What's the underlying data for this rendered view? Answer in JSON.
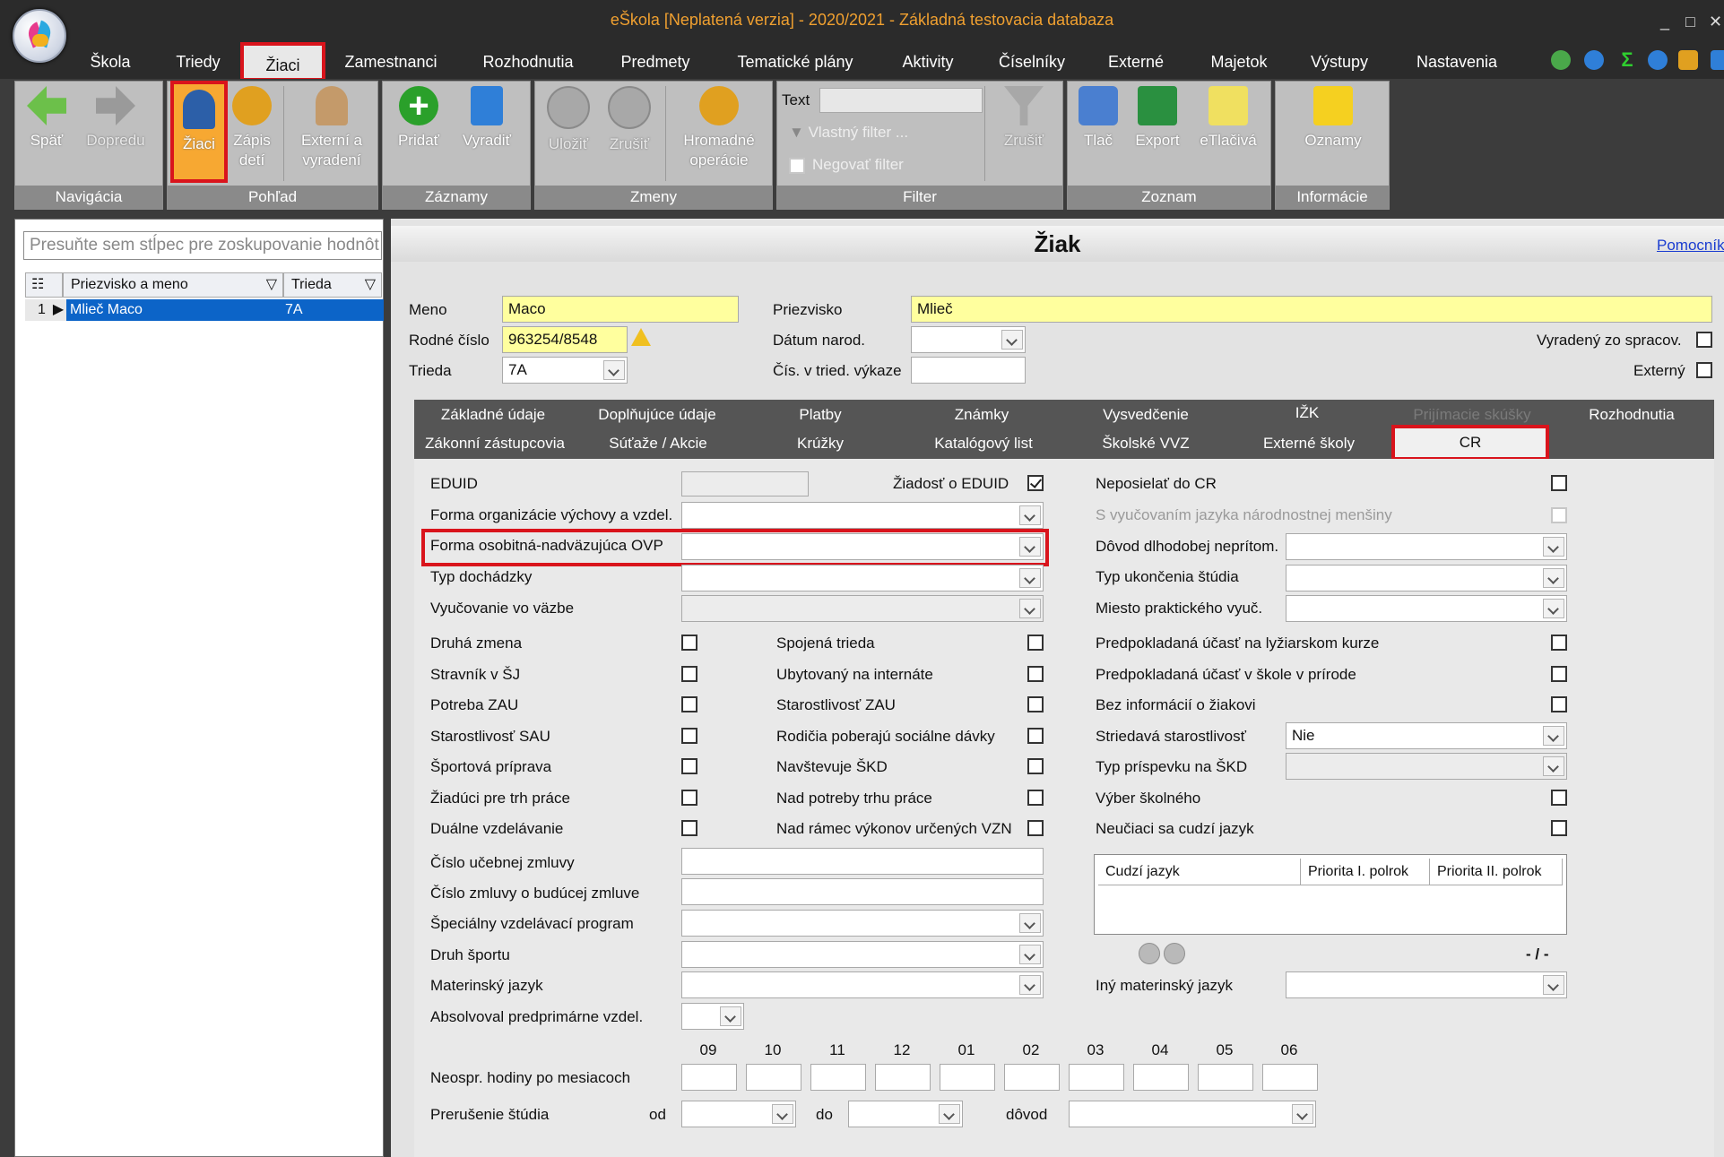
{
  "window": {
    "title": "eŠkola [Neplatená verzia] - 2020/2021 - Základná testovacia databaza",
    "min": "_",
    "max": "□",
    "close": "✕"
  },
  "menu": [
    "Škola",
    "Triedy",
    "Žiaci",
    "Zamestnanci",
    "Rozhodnutia",
    "Predmety",
    "Tematické plány",
    "Aktivity",
    "Číselníky",
    "Externé",
    "Majetok",
    "Výstupy",
    "Nastavenia"
  ],
  "ribbon": {
    "groups": {
      "navigation": "Navigácia",
      "view": "Pohľad",
      "records": "Záznamy",
      "changes": "Zmeny",
      "filter": "Filter",
      "list": "Zoznam",
      "info": "Informácie"
    },
    "buttons": {
      "back": "Späť",
      "forward": "Dopredu",
      "students": "Žiaci",
      "enrollment_1": "Zápis",
      "enrollment_2": "detí",
      "external_1": "Externí a",
      "external_2": "vyradení",
      "add": "Pridať",
      "remove": "Vyradiť",
      "save": "Uložiť",
      "cancel": "Zrušiť",
      "bulk_1": "Hromadné",
      "bulk_2": "operácie",
      "filter_cancel": "Zrušiť",
      "print": "Tlač",
      "export": "Export",
      "print_forms": "eTlačivá",
      "notices": "Oznamy"
    },
    "filter": {
      "text_label": "Text",
      "text_value": "",
      "custom_filter": "Vlastný filter ...",
      "negate_filter": "Negovať filter"
    }
  },
  "left": {
    "group_hint": "Presuňte sem stĺpec pre zoskupovanie hodnôt",
    "columns": {
      "name": "Priezvisko a meno",
      "class": "Trieda"
    },
    "rows": [
      {
        "num": "1",
        "name": "Mlieč Maco",
        "class": "7A"
      }
    ]
  },
  "detail": {
    "title": "Žiak",
    "help": "Pomocník",
    "first_name": {
      "label": "Meno",
      "value": "Maco"
    },
    "surname": {
      "label": "Priezvisko",
      "value": "Mlieč"
    },
    "birth_number": {
      "label": "Rodné číslo",
      "value": "963254/8548"
    },
    "birth_date": {
      "label": "Dátum narod.",
      "value": ""
    },
    "class": {
      "label": "Trieda",
      "value": "7A"
    },
    "class_number": {
      "label": "Čís. v tried. výkaze",
      "value": ""
    },
    "excluded": "Vyradený zo spracov.",
    "external": "Externý"
  },
  "tabs": {
    "row1": [
      "Základné údaje",
      "Doplňujúce údaje",
      "Platby",
      "Známky",
      "Vysvedčenie",
      "IŽK",
      "Prijímacie skúšky",
      "Rozhodnutia"
    ],
    "row2": [
      "Zákonní zástupcovia",
      "Súťaže / Akcie",
      "Krúžky",
      "Katalógový list",
      "Školské VVZ",
      "Externé školy",
      "CR"
    ]
  },
  "cr": {
    "eduid": "EDUID",
    "eduid_request": "Žiadosť o EDUID",
    "no_send": "Neposielať do CR",
    "minority_lang": "S vyučovaním jazyka národnostnej menšiny",
    "org_form": "Forma organizácie výchovy a vzdel.",
    "special_form": "Forma osobitná-nadväzujúca OVP",
    "absence_reason": "Dôvod dlhodobej neprítom.",
    "attendance": "Typ dochádzky",
    "end_type": "Typ ukončenia štúdia",
    "custody": "Vyučovanie vo väzbe",
    "practice_place": "Miesto praktického vyuč.",
    "checks_col1": [
      "Druhá zmena",
      "Stravník v ŠJ",
      "Potreba ZAU",
      "Starostlivosť SAU",
      "Športová príprava",
      "Žiadúci pre trh práce",
      "Duálne vzdelávanie"
    ],
    "checks_col2": [
      "Spojená trieda",
      "Ubytovaný na internáte",
      "Starostlivosť ZAU",
      "Rodičia poberajú sociálne dávky",
      "Navštevuje ŠKD",
      "Nad potreby trhu práce",
      "Nad rámec výkonov určených VZN"
    ],
    "checks_col3": [
      "Predpokladaná účasť na lyžiarskom kurze",
      "Predpokladaná účasť v škole v prírode",
      "Bez informácií o žiakovi"
    ],
    "alternating_care": {
      "label": "Striedavá starostlivosť",
      "value": "Nie"
    },
    "skd_fee": "Typ príspevku na ŠKD",
    "school_choice": "Výber školného",
    "no_foreign_lang": "Neučiaci sa cudzí jazyk",
    "lang_cols": [
      "Cudzí jazyk",
      "Priorita I. polrok",
      "Priorita II. polrok"
    ],
    "pager": "- / -",
    "contract_number": "Číslo učebnej zmluvy",
    "future_contract": "Číslo zmluvy o budúcej zmluve",
    "special_program": "Špeciálny vzdelávací program",
    "sport_type": "Druh športu",
    "mother_tongue": "Materinský jazyk",
    "other_mother_tongue": "Iný materinský jazyk",
    "preprimary": "Absolvoval predprimárne vzdel.",
    "months": [
      "09",
      "10",
      "11",
      "12",
      "01",
      "02",
      "03",
      "04",
      "05",
      "06"
    ],
    "unexcused_hours": "Neospr. hodiny po mesiacoch",
    "interruption": "Prerušenie štúdia",
    "from": "od",
    "to": "do",
    "reason": "dôvod"
  },
  "colors": {
    "accent_red": "#d9141c",
    "title_orange": "#f0a030",
    "selection_blue": "#0c64c8",
    "field_yellow": "#ffff9e"
  }
}
